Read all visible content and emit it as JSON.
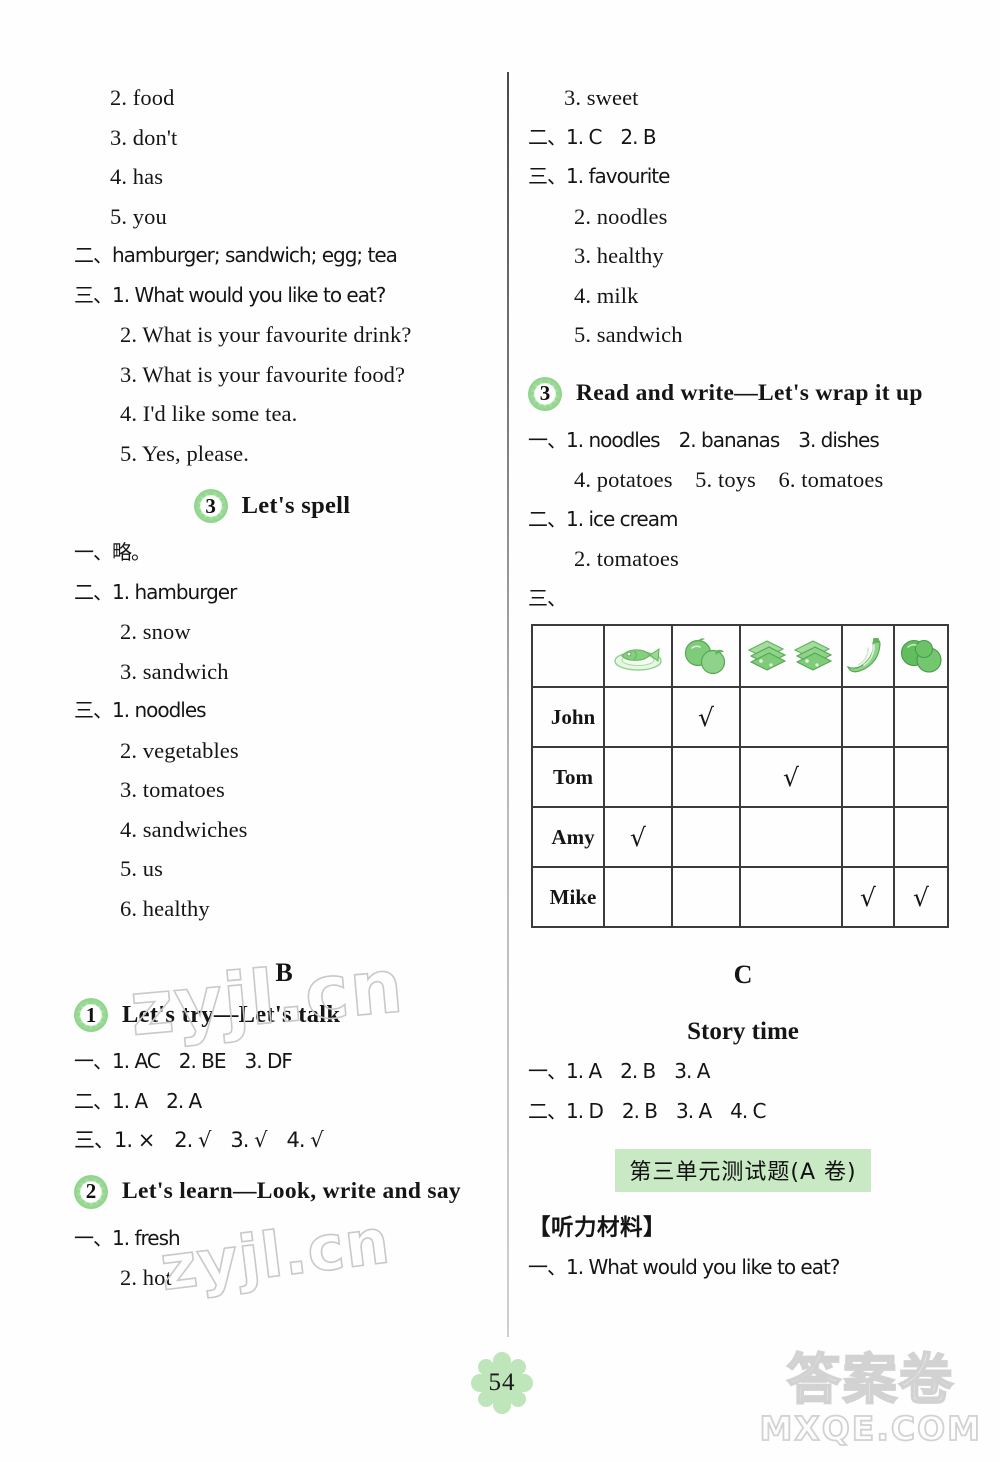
{
  "page": {
    "number": "54",
    "watermark_left_1": "zyjl.cn",
    "watermark_left_2": "zyjl.cn",
    "watermark_corner_cn": "答案卷",
    "watermark_corner_en": "MXQE.COM"
  },
  "left_column": {
    "continued_answers": [
      "2. food",
      "3. don't",
      "4. has",
      "5. you"
    ],
    "item_two": "二、hamburger; sandwich; egg; tea",
    "item_three_lines": [
      "三、1. What would you like to eat?",
      "2. What is your favourite drink?",
      "3. What is your favourite food?",
      "4. I'd like some tea.",
      "5. Yes, please."
    ],
    "section_lets_spell": {
      "badge": "3",
      "title": "Let's spell",
      "lines": [
        "一、略。",
        "二、1. hamburger",
        "2. snow",
        "3. sandwich",
        "三、1. noodles",
        "2. vegetables",
        "3. tomatoes",
        "4. sandwiches",
        "5. us",
        "6. healthy"
      ]
    },
    "part_b_letter": "B",
    "section_lets_try": {
      "badge": "1",
      "title": "Let's try—Let's talk",
      "lines": [
        "一、1. AC　2. BE　3. DF",
        "二、1. A　2. A",
        "三、1. ×　2. √　3. √　4. √"
      ]
    },
    "section_lets_learn": {
      "badge": "2",
      "title": "Let's learn—Look, write and say",
      "lines": [
        "一、1. fresh",
        "2. hot"
      ]
    }
  },
  "right_column": {
    "continued_answers": [
      "3. sweet",
      "二、1. C　2. B",
      "三、1. favourite",
      "2. noodles",
      "3. healthy",
      "4. milk",
      "5. sandwich"
    ],
    "section_read_and_write": {
      "badge": "3",
      "title": "Read and write—Let's wrap it up",
      "lines": [
        "一、1. noodles　2. bananas　3. dishes",
        "4. potatoes　5. toys　6. tomatoes",
        "二、1. ice cream",
        "2. tomatoes",
        "三、"
      ]
    },
    "food_table": {
      "columns": [
        {
          "icon": "",
          "label": "name-column"
        },
        {
          "icon": "fish-on-plate-icon",
          "label": "fish"
        },
        {
          "icon": "tomatoes-icon",
          "label": "tomatoes"
        },
        {
          "icon": "sandwiches-icon",
          "label": "sandwiches"
        },
        {
          "icon": "bananas-icon",
          "label": "bananas"
        },
        {
          "icon": "green-vegetables-icon",
          "label": "vegetables"
        }
      ],
      "rows": [
        {
          "name": "John",
          "checks": [
            false,
            true,
            false,
            false,
            false
          ]
        },
        {
          "name": "Tom",
          "checks": [
            false,
            false,
            true,
            false,
            false
          ]
        },
        {
          "name": "Amy",
          "checks": [
            true,
            false,
            false,
            false,
            false
          ]
        },
        {
          "name": "Mike",
          "checks": [
            false,
            false,
            false,
            true,
            true
          ]
        }
      ],
      "check_mark": "√"
    },
    "part_c_letter": "C",
    "section_story_time": {
      "title": "Story time",
      "lines": [
        "一、1. A　2. B　3. A",
        "二、1. D　2. B　3. A　4. C"
      ]
    },
    "unit_test_banner": "第三单元测试题(A 卷)",
    "listening_heading": "【听力材料】",
    "listening_lines": [
      "一、1. What would you like to eat?"
    ]
  },
  "colors": {
    "badge_green": "#8ed38a",
    "banner_green": "#c9e8c4",
    "icon_green": "#7ccb77",
    "watermark_gray": "#d2d2d2"
  }
}
